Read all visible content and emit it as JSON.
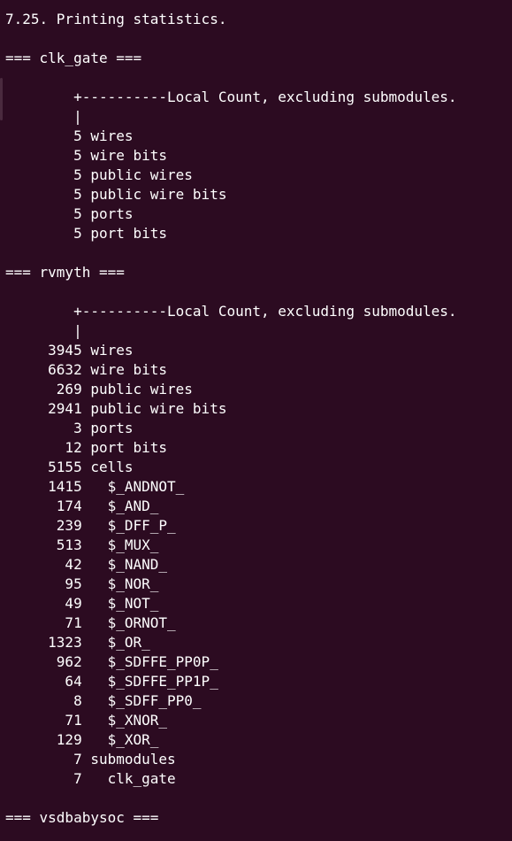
{
  "terminal": {
    "lines": [
      "7.25. Printing statistics.",
      "",
      "=== clk_gate ===",
      "",
      "        +----------Local Count, excluding submodules.",
      "        |",
      "        5 wires",
      "        5 wire bits",
      "        5 public wires",
      "        5 public wire bits",
      "        5 ports",
      "        5 port bits",
      "",
      "=== rvmyth ===",
      "",
      "        +----------Local Count, excluding submodules.",
      "        |",
      "     3945 wires",
      "     6632 wire bits",
      "      269 public wires",
      "     2941 public wire bits",
      "        3 ports",
      "       12 port bits",
      "     5155 cells",
      "     1415   $_ANDNOT_",
      "      174   $_AND_",
      "      239   $_DFF_P_",
      "      513   $_MUX_",
      "       42   $_NAND_",
      "       95   $_NOR_",
      "       49   $_NOT_",
      "       71   $_ORNOT_",
      "     1323   $_OR_",
      "      962   $_SDFFE_PP0P_",
      "       64   $_SDFFE_PP1P_",
      "        8   $_SDFF_PP0_",
      "       71   $_XNOR_",
      "      129   $_XOR_",
      "        7 submodules",
      "        7   clk_gate",
      "",
      "=== vsdbabysoc ==="
    ]
  },
  "colors": {
    "background": "#2c0b21",
    "text": "#ffffff"
  }
}
